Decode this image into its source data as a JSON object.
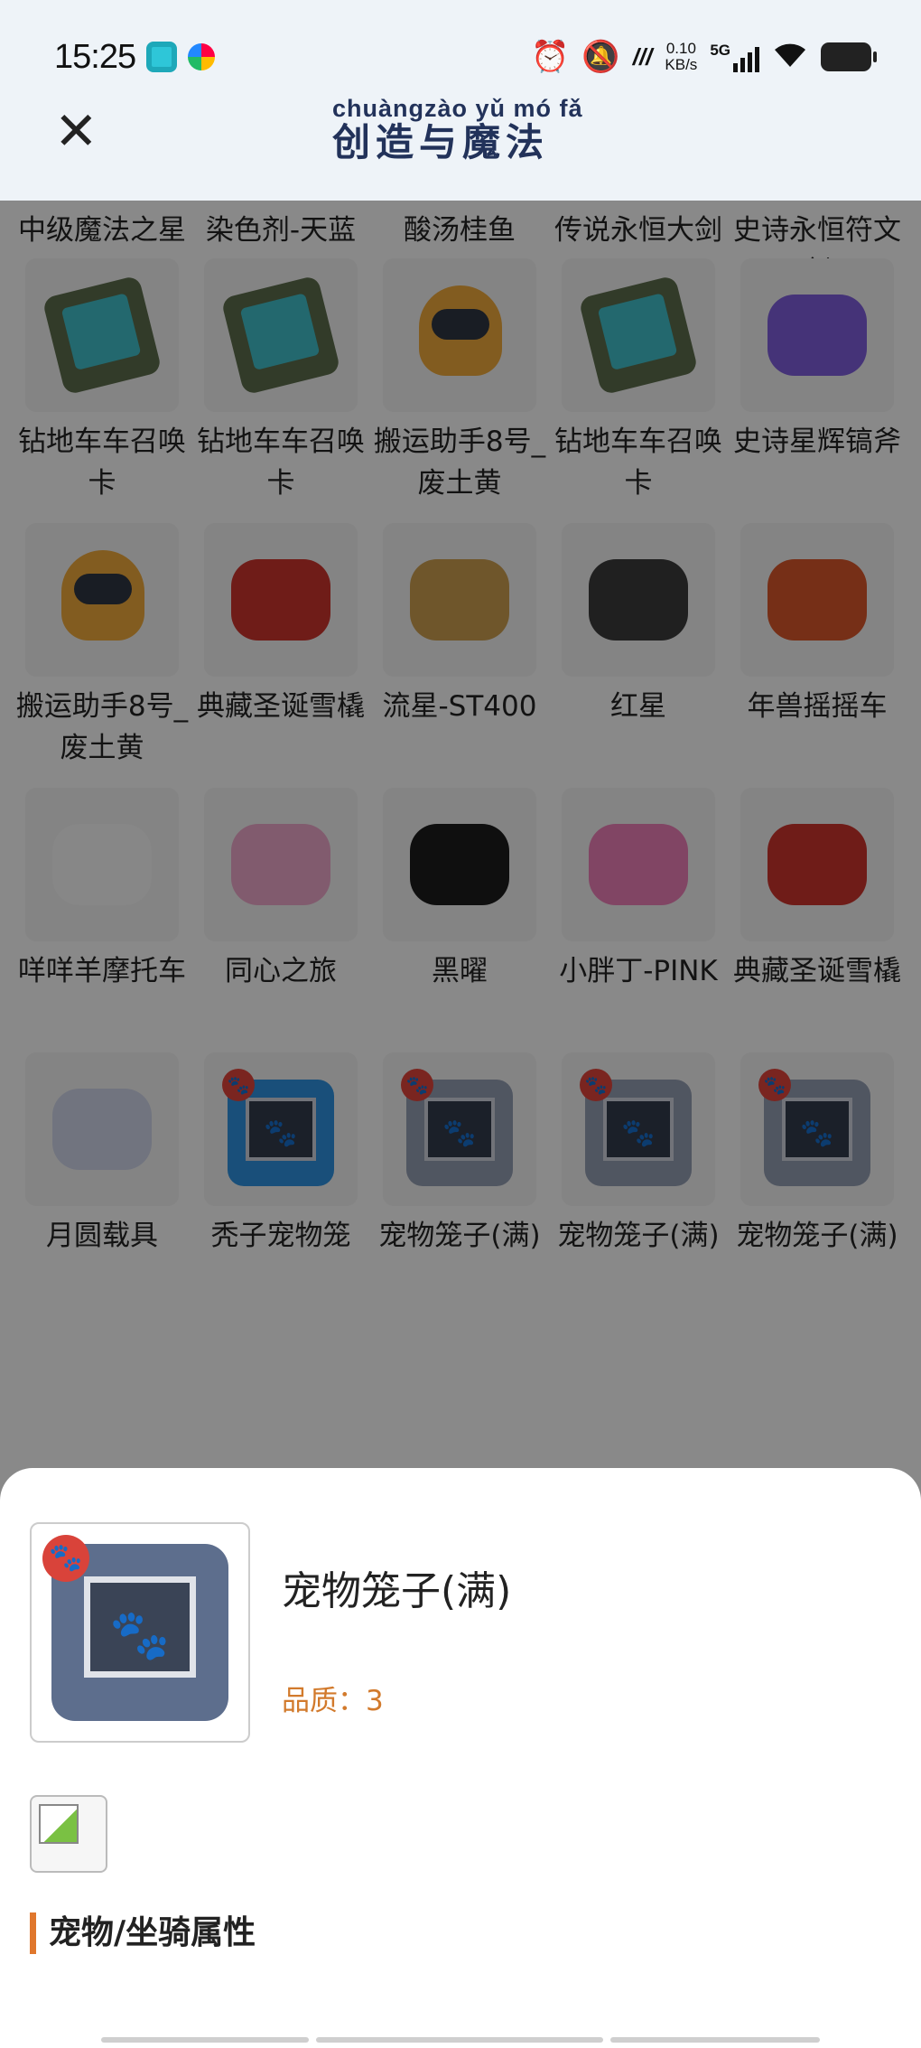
{
  "status_bar": {
    "time": "15:25",
    "net_speed_value": "0.10",
    "net_speed_unit": "KB/s",
    "network": "5G",
    "icons": [
      "app-icon-1",
      "app-icon-2",
      "alarm-icon",
      "mute-icon",
      "nfc-icon",
      "signal-icon",
      "wifi-icon",
      "battery-icon"
    ]
  },
  "header": {
    "title_pinyin": "chuàngzào yǔ mó fǎ",
    "title": "创造与魔法",
    "close_icon": "close-icon"
  },
  "grid": {
    "rows": [
      [
        "中级魔法之星",
        "染色剂-天蓝",
        "酸汤桂鱼",
        "传说永恒大剑",
        "史诗永恒符文剑"
      ],
      [
        "钻地车车召唤卡",
        "钻地车车召唤卡",
        "搬运助手8号_废土黄",
        "钻地车车召唤卡",
        "史诗星辉镐斧"
      ],
      [
        "搬运助手8号_废土黄",
        "典藏圣诞雪橇",
        "流星-ST400",
        "红星",
        "年兽摇摇车"
      ],
      [
        "咩咩羊摩托车",
        "同心之旅",
        "黑曜",
        "小胖丁-PINK",
        "典藏圣诞雪橇"
      ],
      [
        "月圆载具",
        "秃子宠物笼",
        "宠物笼子(满)",
        "宠物笼子(满)",
        "宠物笼子(满)"
      ]
    ]
  },
  "detail": {
    "name": "宠物笼子(满)",
    "quality": "品质：3",
    "section_title": "宠物/坐骑属性"
  },
  "colors": {
    "header_bg": "#eef3f8",
    "title_color": "#22325a",
    "accent_orange": "#e0772d",
    "quality_color": "#d27a2c",
    "paw_badge_red": "#d9433a"
  }
}
